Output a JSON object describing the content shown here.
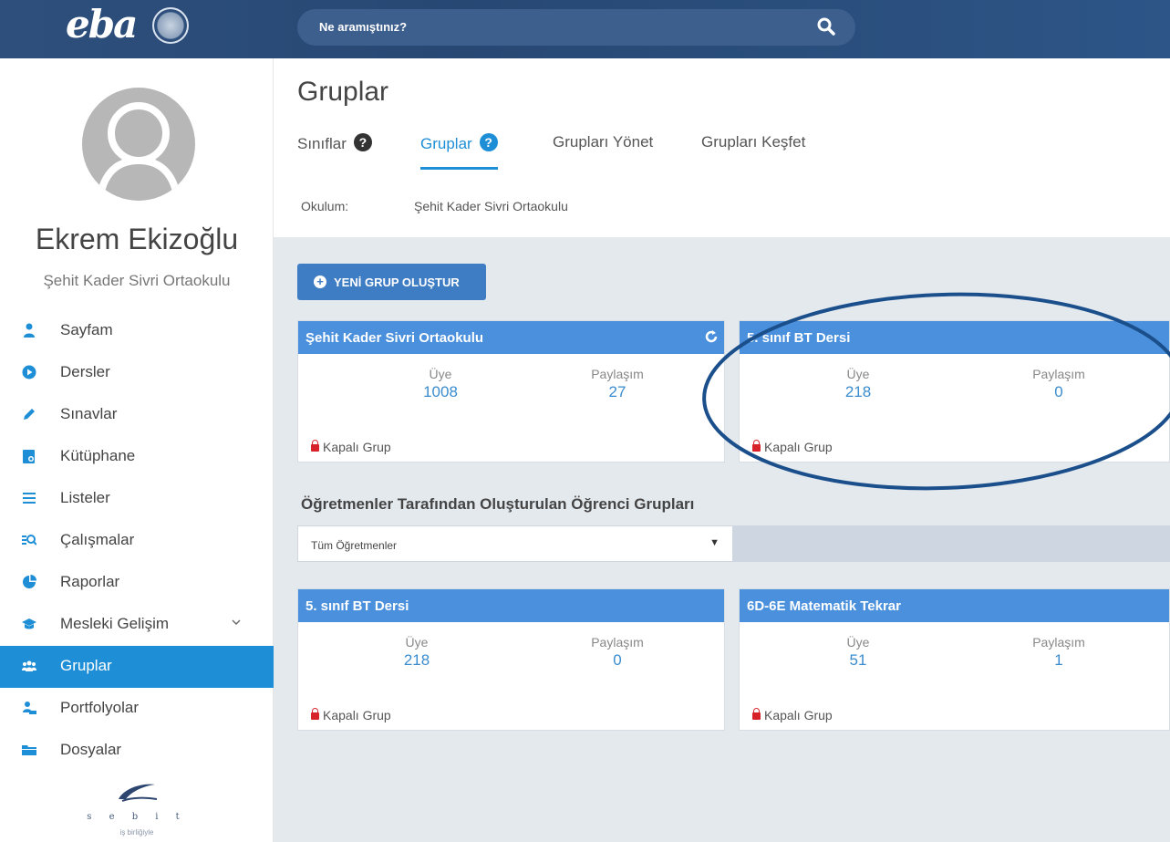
{
  "header": {
    "logo_text": "eba",
    "search_placeholder": "Ne aramıştınız?"
  },
  "user": {
    "name": "Ekrem Ekizoğlu",
    "school": "Şehit Kader Sivri Ortaokulu"
  },
  "nav": {
    "items": [
      {
        "label": "Sayfam",
        "icon": "user-icon"
      },
      {
        "label": "Dersler",
        "icon": "play-icon"
      },
      {
        "label": "Sınavlar",
        "icon": "pencil-icon"
      },
      {
        "label": "Kütüphane",
        "icon": "library-icon"
      },
      {
        "label": "Listeler",
        "icon": "list-icon"
      },
      {
        "label": "Çalışmalar",
        "icon": "search-list-icon"
      },
      {
        "label": "Raporlar",
        "icon": "pie-chart-icon"
      },
      {
        "label": "Mesleki Gelişim",
        "icon": "graduation-cap-icon"
      },
      {
        "label": "Gruplar",
        "icon": "users-icon",
        "active": true
      },
      {
        "label": "Portfolyolar",
        "icon": "portfolio-icon"
      },
      {
        "label": "Dosyalar",
        "icon": "folder-icon"
      }
    ]
  },
  "footer": {
    "brand_letters": "s e b i t",
    "tagline": "iş birliğiyle"
  },
  "page": {
    "title": "Gruplar",
    "tabs": [
      {
        "label": "Sınıflar",
        "help": true
      },
      {
        "label": "Gruplar",
        "help": true,
        "active": true
      },
      {
        "label": "Grupları Yönet"
      },
      {
        "label": "Grupları Keşfet"
      }
    ],
    "school_label": "Okulum:",
    "school_value": "Şehit Kader Sivri Ortaokulu",
    "new_group_button": "YENİ GRUP OLUŞTUR",
    "section_title": "Öğretmenler Tarafından Oluşturulan Öğrenci Grupları",
    "teacher_filter": "Tüm Öğretmenler"
  },
  "cards": [
    {
      "title": "Şehit Kader Sivri Ortaokulu",
      "member_label": "Üye",
      "members": "1008",
      "share_label": "Paylaşım",
      "shares": "27",
      "status": "Kapalı Grup"
    },
    {
      "title": "5. sınıf BT Dersi",
      "member_label": "Üye",
      "members": "218",
      "share_label": "Paylaşım",
      "shares": "0",
      "status": "Kapalı Grup"
    },
    {
      "title": "5. sınıf BT Dersi",
      "member_label": "Üye",
      "members": "218",
      "share_label": "Paylaşım",
      "shares": "0",
      "status": "Kapalı Grup"
    },
    {
      "title": "6D-6E Matematik Tekrar",
      "member_label": "Üye",
      "members": "51",
      "share_label": "Paylaşım",
      "shares": "1",
      "status": "Kapalı Grup"
    }
  ],
  "colors": {
    "header_bg": "#2e4f7c",
    "accent": "#1e8ed6",
    "card_header": "#4a90dc",
    "button": "#3e7cc4",
    "lock": "#d8222a",
    "annotation": "#1a4f8c"
  }
}
